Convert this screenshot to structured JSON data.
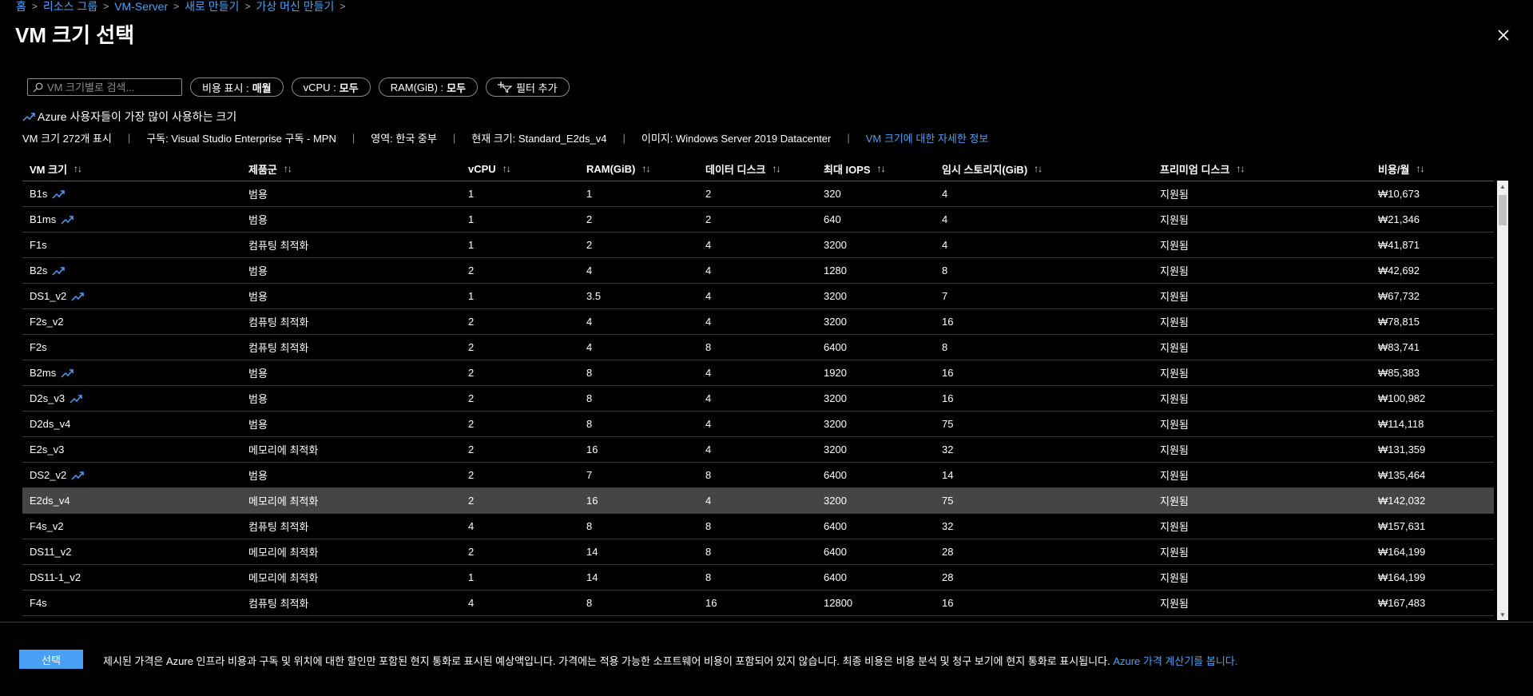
{
  "breadcrumb": {
    "home": "홈",
    "resource_group": "리소스 그룹",
    "server": "VM-Server",
    "create": "새로 만들기",
    "create_vm": "가상 머신 만들기"
  },
  "title": "VM 크기 선택",
  "filters": {
    "search_placeholder": "VM 크기별로 검색...",
    "cost_label": "비용 표시 :",
    "cost_value": "매월",
    "vcpu_label": "vCPU :",
    "vcpu_value": "모두",
    "ram_label": "RAM(GiB) :",
    "ram_value": "모두",
    "add_filter": "필터 추가"
  },
  "popular_label": "Azure 사용자들이 가장 많이 사용하는 크기",
  "info": {
    "count": "VM 크기 272개 표시",
    "subscription": "구독: Visual Studio Enterprise 구독 - MPN",
    "region": "영역: 한국 중부",
    "current_size": "현재 크기: Standard_E2ds_v4",
    "image": "이미지: Windows Server 2019 Datacenter",
    "more_info_link": "VM 크기에 대한 자세한 정보"
  },
  "sort_glyph": "↑↓",
  "columns": [
    "VM 크기",
    "제품군",
    "vCPU",
    "RAM(GiB)",
    "데이터 디스크",
    "최대 IOPS",
    "임시 스토리지(GiB)",
    "프리미엄 디스크",
    "비용/월"
  ],
  "rows": [
    {
      "name": "B1s",
      "popular": true,
      "family": "범용",
      "vcpu": "1",
      "ram": "1",
      "disks": "2",
      "iops": "320",
      "temp": "4",
      "premium": "지원됨",
      "cost": "₩10,673"
    },
    {
      "name": "B1ms",
      "popular": true,
      "family": "범용",
      "vcpu": "1",
      "ram": "2",
      "disks": "2",
      "iops": "640",
      "temp": "4",
      "premium": "지원됨",
      "cost": "₩21,346"
    },
    {
      "name": "F1s",
      "popular": false,
      "family": "컴퓨팅 최적화",
      "vcpu": "1",
      "ram": "2",
      "disks": "4",
      "iops": "3200",
      "temp": "4",
      "premium": "지원됨",
      "cost": "₩41,871"
    },
    {
      "name": "B2s",
      "popular": true,
      "family": "범용",
      "vcpu": "2",
      "ram": "4",
      "disks": "4",
      "iops": "1280",
      "temp": "8",
      "premium": "지원됨",
      "cost": "₩42,692"
    },
    {
      "name": "DS1_v2",
      "popular": true,
      "family": "범용",
      "vcpu": "1",
      "ram": "3.5",
      "disks": "4",
      "iops": "3200",
      "temp": "7",
      "premium": "지원됨",
      "cost": "₩67,732"
    },
    {
      "name": "F2s_v2",
      "popular": false,
      "family": "컴퓨팅 최적화",
      "vcpu": "2",
      "ram": "4",
      "disks": "4",
      "iops": "3200",
      "temp": "16",
      "premium": "지원됨",
      "cost": "₩78,815"
    },
    {
      "name": "F2s",
      "popular": false,
      "family": "컴퓨팅 최적화",
      "vcpu": "2",
      "ram": "4",
      "disks": "8",
      "iops": "6400",
      "temp": "8",
      "premium": "지원됨",
      "cost": "₩83,741"
    },
    {
      "name": "B2ms",
      "popular": true,
      "family": "범용",
      "vcpu": "2",
      "ram": "8",
      "disks": "4",
      "iops": "1920",
      "temp": "16",
      "premium": "지원됨",
      "cost": "₩85,383"
    },
    {
      "name": "D2s_v3",
      "popular": true,
      "family": "범용",
      "vcpu": "2",
      "ram": "8",
      "disks": "4",
      "iops": "3200",
      "temp": "16",
      "premium": "지원됨",
      "cost": "₩100,982"
    },
    {
      "name": "D2ds_v4",
      "popular": false,
      "family": "범용",
      "vcpu": "2",
      "ram": "8",
      "disks": "4",
      "iops": "3200",
      "temp": "75",
      "premium": "지원됨",
      "cost": "₩114,118"
    },
    {
      "name": "E2s_v3",
      "popular": false,
      "family": "메모리에 최적화",
      "vcpu": "2",
      "ram": "16",
      "disks": "4",
      "iops": "3200",
      "temp": "32",
      "premium": "지원됨",
      "cost": "₩131,359"
    },
    {
      "name": "DS2_v2",
      "popular": true,
      "family": "범용",
      "vcpu": "2",
      "ram": "7",
      "disks": "8",
      "iops": "6400",
      "temp": "14",
      "premium": "지원됨",
      "cost": "₩135,464"
    },
    {
      "name": "E2ds_v4",
      "popular": false,
      "selected": true,
      "family": "메모리에 최적화",
      "vcpu": "2",
      "ram": "16",
      "disks": "4",
      "iops": "3200",
      "temp": "75",
      "premium": "지원됨",
      "cost": "₩142,032"
    },
    {
      "name": "F4s_v2",
      "popular": false,
      "family": "컴퓨팅 최적화",
      "vcpu": "4",
      "ram": "8",
      "disks": "8",
      "iops": "6400",
      "temp": "32",
      "premium": "지원됨",
      "cost": "₩157,631"
    },
    {
      "name": "DS11_v2",
      "popular": false,
      "family": "메모리에 최적화",
      "vcpu": "2",
      "ram": "14",
      "disks": "8",
      "iops": "6400",
      "temp": "28",
      "premium": "지원됨",
      "cost": "₩164,199"
    },
    {
      "name": "DS11-1_v2",
      "popular": false,
      "family": "메모리에 최적화",
      "vcpu": "1",
      "ram": "14",
      "disks": "8",
      "iops": "6400",
      "temp": "28",
      "premium": "지원됨",
      "cost": "₩164,199"
    },
    {
      "name": "F4s",
      "popular": false,
      "family": "컴퓨팅 최적화",
      "vcpu": "4",
      "ram": "8",
      "disks": "16",
      "iops": "12800",
      "temp": "16",
      "premium": "지원됨",
      "cost": "₩167,483"
    }
  ],
  "footer": {
    "select_button": "선택",
    "note": "제시된 가격은 Azure 인프라 비용과 구독 및 위치에 대한 할인만 포함된 현지 통화로 표시된 예상액입니다. 가격에는 적용 가능한 소프트웨어 비용이 포함되어 있지 않습니다. 최종 비용은 비용 분석 및 청구 보기에 현지 통화로 표시됩니다.",
    "calculator_link": "Azure 가격 계산기를 봅니다."
  },
  "colors": {
    "accent": "#4aa0f5",
    "background": "#000000",
    "selected_row": "#454545"
  },
  "icons": [
    "close-icon",
    "search-icon",
    "add-filter-icon",
    "trending-icon"
  ]
}
